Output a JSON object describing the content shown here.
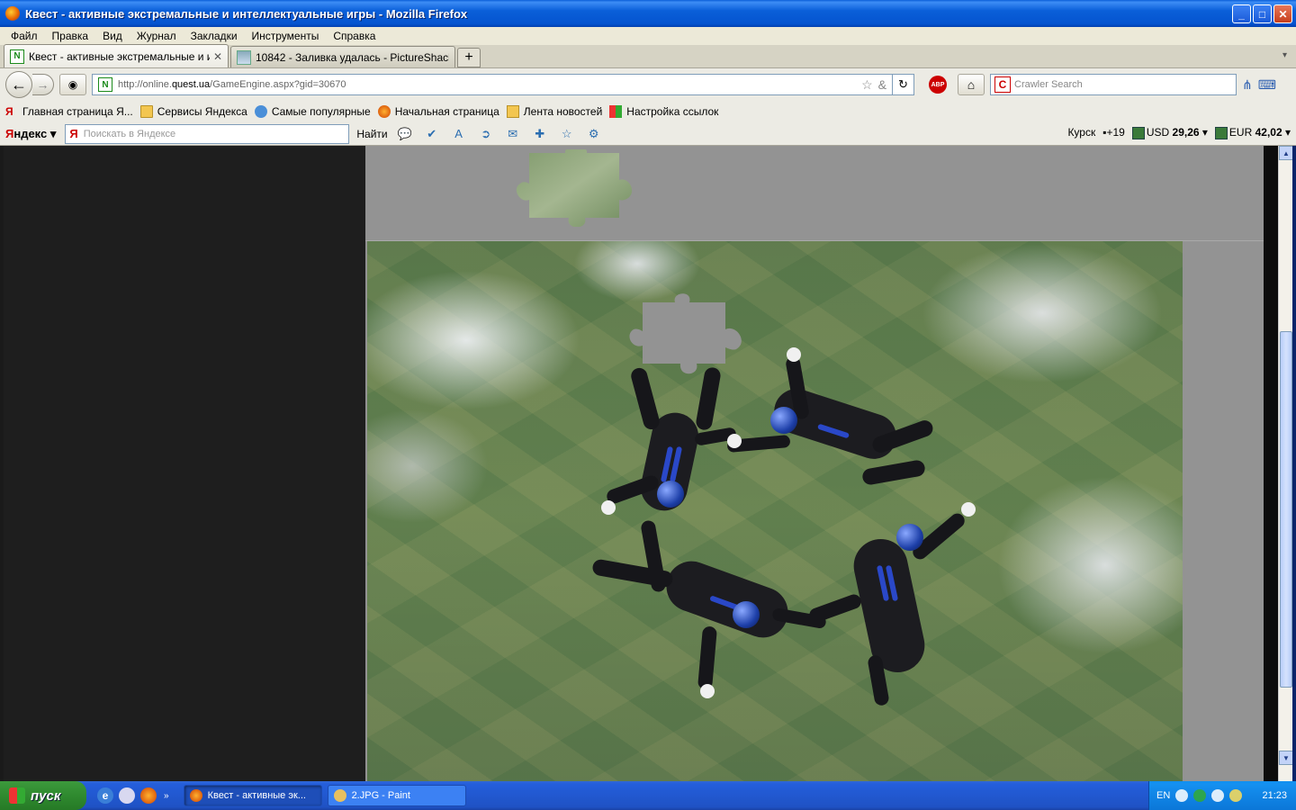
{
  "window": {
    "title": "Квест - активные экстремальные и интеллектуальные игры - Mozilla Firefox",
    "buttons": {
      "minimize": "_",
      "maximize": "□",
      "close": "✕"
    }
  },
  "menu": [
    "Файл",
    "Правка",
    "Вид",
    "Журнал",
    "Закладки",
    "Инструменты",
    "Справка"
  ],
  "tabs": [
    {
      "label": "Квест - активные экстремальные и ин...",
      "favicon": "N",
      "active": true,
      "close": "✕"
    },
    {
      "label": "10842 - Заливка удалась - PictureShack...",
      "favicon": "",
      "active": false
    }
  ],
  "tab_new": "+",
  "tab_list": "▾",
  "nav": {
    "back": "←",
    "forward": "→",
    "url_prefix": "http://online.",
    "url_domain": "quest.ua",
    "url_rest": "/GameEngine.aspx?gid=30670",
    "url_favicon": "N",
    "reload": "↻",
    "abp": "ABP",
    "home": "⌂",
    "search_engine": "C",
    "search_placeholder": "Crawler Search"
  },
  "bookmarks": [
    {
      "label": "Главная страница Я...",
      "icon": "yandex-icon"
    },
    {
      "label": "Сервисы Яндекса",
      "icon": "folder-icon"
    },
    {
      "label": "Самые популярные",
      "icon": "search-icon"
    },
    {
      "label": "Начальная страница",
      "icon": "firefox-icon"
    },
    {
      "label": "Лента новостей",
      "icon": "rss-icon"
    },
    {
      "label": "Настройка ссылок",
      "icon": "windows-icon"
    }
  ],
  "yandex": {
    "logo_first": "Я",
    "logo_rest": "ндекс",
    "search_placeholder": "Поискать в Яндексе",
    "find_label": "Найти",
    "city": "Курск",
    "temp": "+19",
    "usd_label": "USD",
    "usd_value": "29,26",
    "eur_label": "EUR",
    "eur_value": "42,02"
  },
  "taskbar": {
    "start_label": "пуск",
    "items": [
      {
        "label": "Квест - активные эк...",
        "active": true
      },
      {
        "label": "2.JPG - Paint",
        "active": false
      }
    ],
    "lang": "EN",
    "time": "21:23"
  },
  "colors": {
    "titlebar": "#0a5fd8",
    "game_background": "#939393",
    "left_panel": "#1e1e1e"
  }
}
